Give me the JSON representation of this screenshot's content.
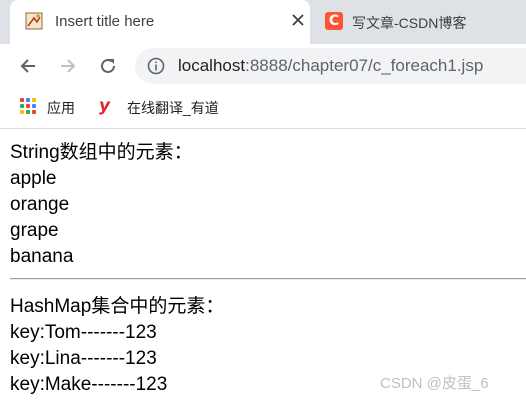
{
  "tabs": [
    {
      "title": "Insert title here",
      "active": true,
      "icon": "document-icon"
    },
    {
      "title": "写文章-CSDN博客",
      "active": false,
      "icon": "csdn-icon",
      "favicon_letter": "C"
    }
  ],
  "toolbar": {
    "url_host": "localhost",
    "url_rest": ":8888/chapter07/c_foreach1.jsp"
  },
  "bookmarks": [
    {
      "label": "应用",
      "icon": "apps-grid-icon"
    },
    {
      "label": "在线翻译_有道",
      "icon": "youdao-icon",
      "icon_glyph": "y"
    }
  ],
  "page": {
    "array_heading": "String数组中的元素：",
    "array_items": [
      "apple",
      "orange",
      "grape",
      "banana"
    ],
    "map_heading": "HashMap集合中的元素：",
    "map_items": [
      "key:Tom-------123",
      "key:Lina-------123",
      "key:Make-------123"
    ]
  },
  "watermark": "CSDN @皮蛋_6",
  "colors": {
    "tabstrip_bg": "#dee1e6",
    "csdn_brand": "#fc5531",
    "youdao_red": "#e3262d"
  }
}
